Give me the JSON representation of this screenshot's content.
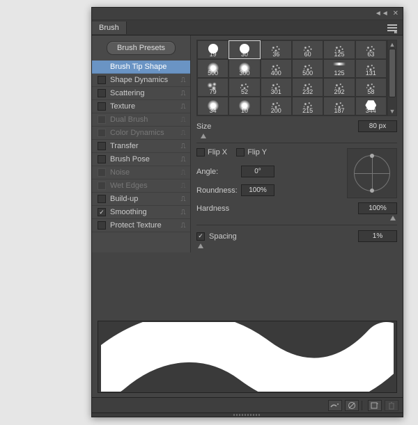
{
  "tab": {
    "title": "Brush"
  },
  "buttons": {
    "presets": "Brush Presets"
  },
  "options": [
    {
      "key": "tip",
      "label": "Brush Tip Shape",
      "hasCheckbox": false,
      "checked": false,
      "selected": true,
      "hasLock": false,
      "disabled": false
    },
    {
      "key": "shapedyn",
      "label": "Shape Dynamics",
      "hasCheckbox": true,
      "checked": false,
      "selected": false,
      "hasLock": true,
      "disabled": false
    },
    {
      "key": "scatter",
      "label": "Scattering",
      "hasCheckbox": true,
      "checked": false,
      "selected": false,
      "hasLock": true,
      "disabled": false
    },
    {
      "key": "texture",
      "label": "Texture",
      "hasCheckbox": true,
      "checked": false,
      "selected": false,
      "hasLock": true,
      "disabled": false
    },
    {
      "key": "dual",
      "label": "Dual Brush",
      "hasCheckbox": true,
      "checked": false,
      "selected": false,
      "hasLock": true,
      "disabled": true
    },
    {
      "key": "colordyn",
      "label": "Color Dynamics",
      "hasCheckbox": true,
      "checked": false,
      "selected": false,
      "hasLock": true,
      "disabled": true
    },
    {
      "key": "transfer",
      "label": "Transfer",
      "hasCheckbox": true,
      "checked": false,
      "selected": false,
      "hasLock": true,
      "disabled": false
    },
    {
      "key": "pose",
      "label": "Brush Pose",
      "hasCheckbox": true,
      "checked": false,
      "selected": false,
      "hasLock": true,
      "disabled": false
    },
    {
      "key": "noise",
      "label": "Noise",
      "hasCheckbox": true,
      "checked": false,
      "selected": false,
      "hasLock": true,
      "disabled": true
    },
    {
      "key": "wet",
      "label": "Wet Edges",
      "hasCheckbox": true,
      "checked": false,
      "selected": false,
      "hasLock": true,
      "disabled": true
    },
    {
      "key": "buildup",
      "label": "Build-up",
      "hasCheckbox": true,
      "checked": false,
      "selected": false,
      "hasLock": true,
      "disabled": false
    },
    {
      "key": "smooth",
      "label": "Smoothing",
      "hasCheckbox": true,
      "checked": true,
      "selected": false,
      "hasLock": true,
      "disabled": false
    },
    {
      "key": "protect",
      "label": "Protect Texture",
      "hasCheckbox": true,
      "checked": false,
      "selected": false,
      "hasLock": true,
      "disabled": false
    }
  ],
  "swatches": [
    {
      "size": "19",
      "shape": "dot-hard",
      "selected": false
    },
    {
      "size": "30",
      "shape": "dot-hard",
      "selected": true
    },
    {
      "size": "36",
      "shape": "speck",
      "selected": false
    },
    {
      "size": "60",
      "shape": "speck",
      "selected": false
    },
    {
      "size": "125",
      "shape": "speck",
      "selected": false
    },
    {
      "size": "63",
      "shape": "speck",
      "selected": false
    },
    {
      "size": "500",
      "shape": "dot-soft",
      "selected": false
    },
    {
      "size": "300",
      "shape": "dot-soft",
      "selected": false
    },
    {
      "size": "400",
      "shape": "speck",
      "selected": false
    },
    {
      "size": "500",
      "shape": "speck",
      "selected": false
    },
    {
      "size": "125",
      "shape": "streak",
      "selected": false
    },
    {
      "size": "131",
      "shape": "speck",
      "selected": false
    },
    {
      "size": "79",
      "shape": "multidot",
      "selected": false
    },
    {
      "size": "52",
      "shape": "speck",
      "selected": false
    },
    {
      "size": "301",
      "shape": "speck",
      "selected": false
    },
    {
      "size": "232",
      "shape": "speck",
      "selected": false
    },
    {
      "size": "292",
      "shape": "speck",
      "selected": false
    },
    {
      "size": "58",
      "shape": "speck",
      "selected": false
    },
    {
      "size": "34",
      "shape": "dot-soft",
      "selected": false
    },
    {
      "size": "10",
      "shape": "dot-soft",
      "selected": false
    },
    {
      "size": "200",
      "shape": "speck",
      "selected": false
    },
    {
      "size": "215",
      "shape": "speck",
      "selected": false
    },
    {
      "size": "187",
      "shape": "speck",
      "selected": false
    },
    {
      "size": "344",
      "shape": "hex",
      "selected": false
    }
  ],
  "fields": {
    "size_label": "Size",
    "size_value": "80 px",
    "flipx": "Flip X",
    "flipy": "Flip Y",
    "angle_label": "Angle:",
    "angle_value": "0°",
    "roundness_label": "Roundness:",
    "roundness_value": "100%",
    "hardness_label": "Hardness",
    "hardness_value": "100%",
    "spacing_label": "Spacing",
    "spacing_value": "1%"
  },
  "lock_glyph": "🔒"
}
